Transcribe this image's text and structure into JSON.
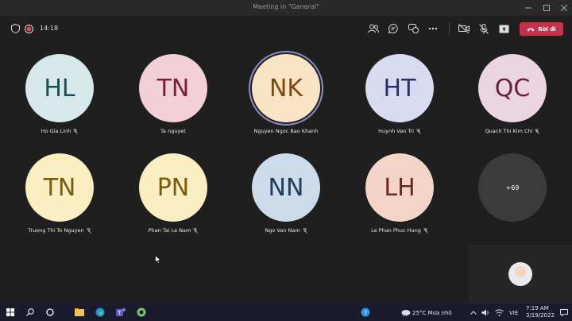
{
  "window": {
    "title": "Meeting in \"General\""
  },
  "toolbar": {
    "timer": "14:18",
    "leave_label": "Rời đi",
    "icons": [
      "shield-icon",
      "record-icon",
      "people-icon",
      "chat-icon",
      "reactions-icon",
      "more-icon",
      "camera-off-icon",
      "mic-off-icon",
      "share-icon",
      "phone-icon"
    ]
  },
  "participants": [
    {
      "initials": "HL",
      "name": "Ho Gia Linh",
      "muted": true,
      "bg": "#d7e8ea",
      "fg": "#1e4c56"
    },
    {
      "initials": "TN",
      "name": "Ta nguyet",
      "muted": false,
      "bg": "#f3d0d8",
      "fg": "#7a1f34"
    },
    {
      "initials": "NK",
      "name": "Nguyen Ngoc Bao Khanh",
      "muted": false,
      "bg": "#fbe3c6",
      "fg": "#7a4a12",
      "speaking": true
    },
    {
      "initials": "HT",
      "name": "Huynh Van Tri",
      "muted": true,
      "bg": "#d9dbf0",
      "fg": "#2b2f6b"
    },
    {
      "initials": "QC",
      "name": "Quach Thi Kim Chi",
      "muted": true,
      "bg": "#ebd5e0",
      "fg": "#6a1f3e"
    },
    {
      "initials": "TN",
      "name": "Truong Thi To Nguyen",
      "muted": true,
      "bg": "#fbeec0",
      "fg": "#7a5a10"
    },
    {
      "initials": "PN",
      "name": "Phan Tai Le Nam",
      "muted": true,
      "bg": "#fbeec0",
      "fg": "#7a5a10"
    },
    {
      "initials": "NN",
      "name": "Ngo Van Nam",
      "muted": true,
      "bg": "#cddcea",
      "fg": "#1f3c5a"
    },
    {
      "initials": "LH",
      "name": "Le Phan Phuc Hung",
      "muted": true,
      "bg": "#f3d4c7",
      "fg": "#6b2a1c"
    }
  ],
  "overflow": {
    "label": "+69"
  },
  "taskbar": {
    "weather": "25°C  Mưa nhỏ",
    "language": "VIE",
    "time": "7:19 AM",
    "date": "3/19/2022"
  }
}
